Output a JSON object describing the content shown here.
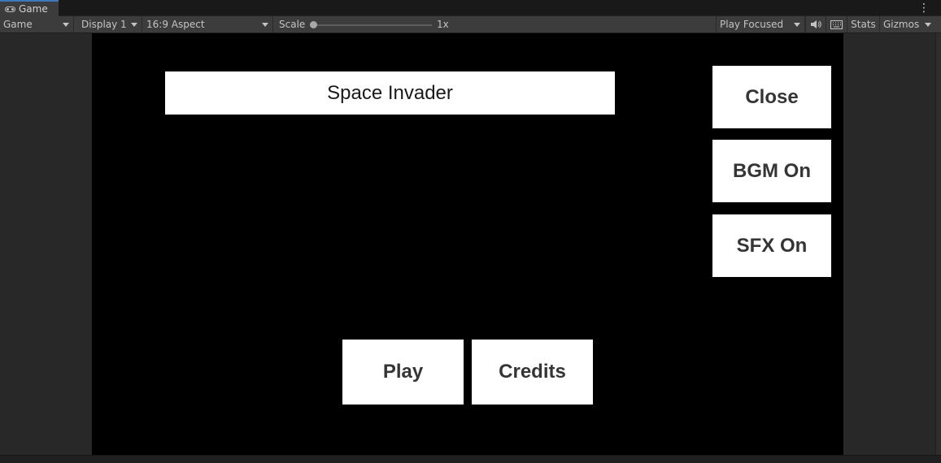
{
  "window": {
    "tab_label": "Game",
    "tab_icon": "gamepad-icon",
    "menu_icon": "kebab-menu-icon"
  },
  "toolbar": {
    "view_mode": "Game",
    "display": "Display 1",
    "aspect": "16:9 Aspect",
    "scale_label": "Scale",
    "scale_value": "1x",
    "scale_level": 0,
    "play_mode": "Play Focused",
    "audio_icon": "speaker-icon",
    "stats_icon": "keyboard-icon",
    "stats_label": "Stats",
    "gizmos_label": "Gizmos"
  },
  "game": {
    "title": "Space Invader",
    "close_label": "Close",
    "bgm_label": "BGM On",
    "sfx_label": "SFX On",
    "play_label": "Play",
    "credits_label": "Credits"
  }
}
